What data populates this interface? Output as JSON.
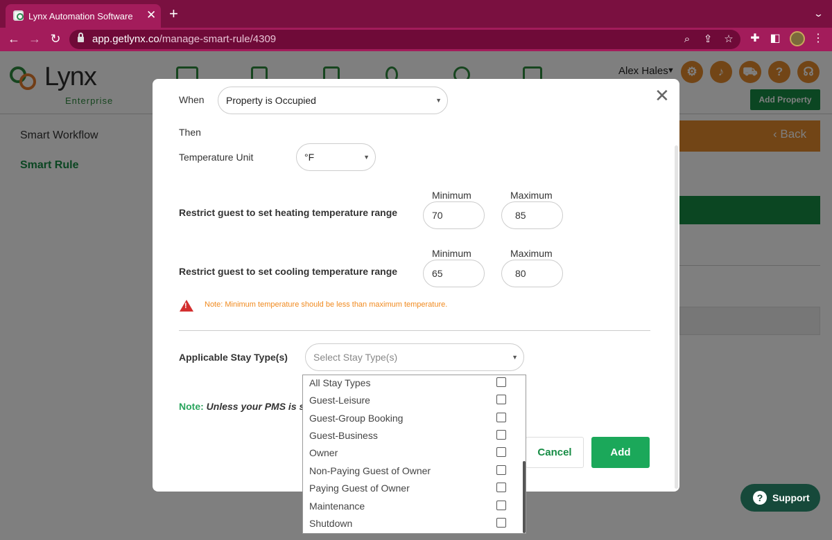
{
  "browser": {
    "tab_title": "Lynx Automation Software",
    "tab_close": "✕",
    "new_tab": "+",
    "url_host": "app.getlynx.co",
    "url_path": "/manage-smart-rule/4309"
  },
  "app": {
    "logo_text": "Lynx",
    "logo_sub": "Enterprise",
    "user_name": "Alex Hales",
    "add_property_label": "Add Property",
    "back_label": "‹ Back",
    "sidebar": {
      "items": [
        {
          "label": "Smart Workflow"
        },
        {
          "label": "Smart Rule"
        }
      ]
    },
    "support_label": "Support"
  },
  "modal": {
    "when_label": "When",
    "when_value": "Property is Occupied",
    "then_label": "Then",
    "temp_unit_label": "Temperature Unit",
    "temp_unit_value": "°F",
    "heating_label": "Restrict guest to set heating temperature range",
    "cooling_label": "Restrict guest to set cooling temperature range",
    "minimum_label": "Minimum",
    "maximum_label": "Maximum",
    "heating_min": "70",
    "heating_max": "85",
    "cooling_min": "65",
    "cooling_max": "80",
    "warning_text": "Note: Minimum temperature should be less than maximum temperature.",
    "stay_type_label": "Applicable Stay Type(s)",
    "stay_type_placeholder": "Select Stay Type(s)",
    "note_label": "Note:",
    "note_text": "Unless your PMS is sup",
    "cancel_label": "Cancel",
    "add_label": "Add"
  },
  "stay_types": [
    {
      "label": "All Stay Types",
      "checked": false
    },
    {
      "label": "Guest-Leisure",
      "checked": false
    },
    {
      "label": "Guest-Group Booking",
      "checked": false
    },
    {
      "label": "Guest-Business",
      "checked": false
    },
    {
      "label": "Owner",
      "checked": false
    },
    {
      "label": "Non-Paying Guest of Owner",
      "checked": false
    },
    {
      "label": "Paying Guest of Owner",
      "checked": false
    },
    {
      "label": "Maintenance",
      "checked": false
    },
    {
      "label": "Shutdown",
      "checked": false
    }
  ],
  "colors": {
    "browser_frame": "#7a1040",
    "browser_toolbar": "#a31c5b",
    "brand_green": "#178c45",
    "brand_orange": "#e58a2c",
    "warning_red": "#d32f2f",
    "warning_text": "#f0891d"
  }
}
